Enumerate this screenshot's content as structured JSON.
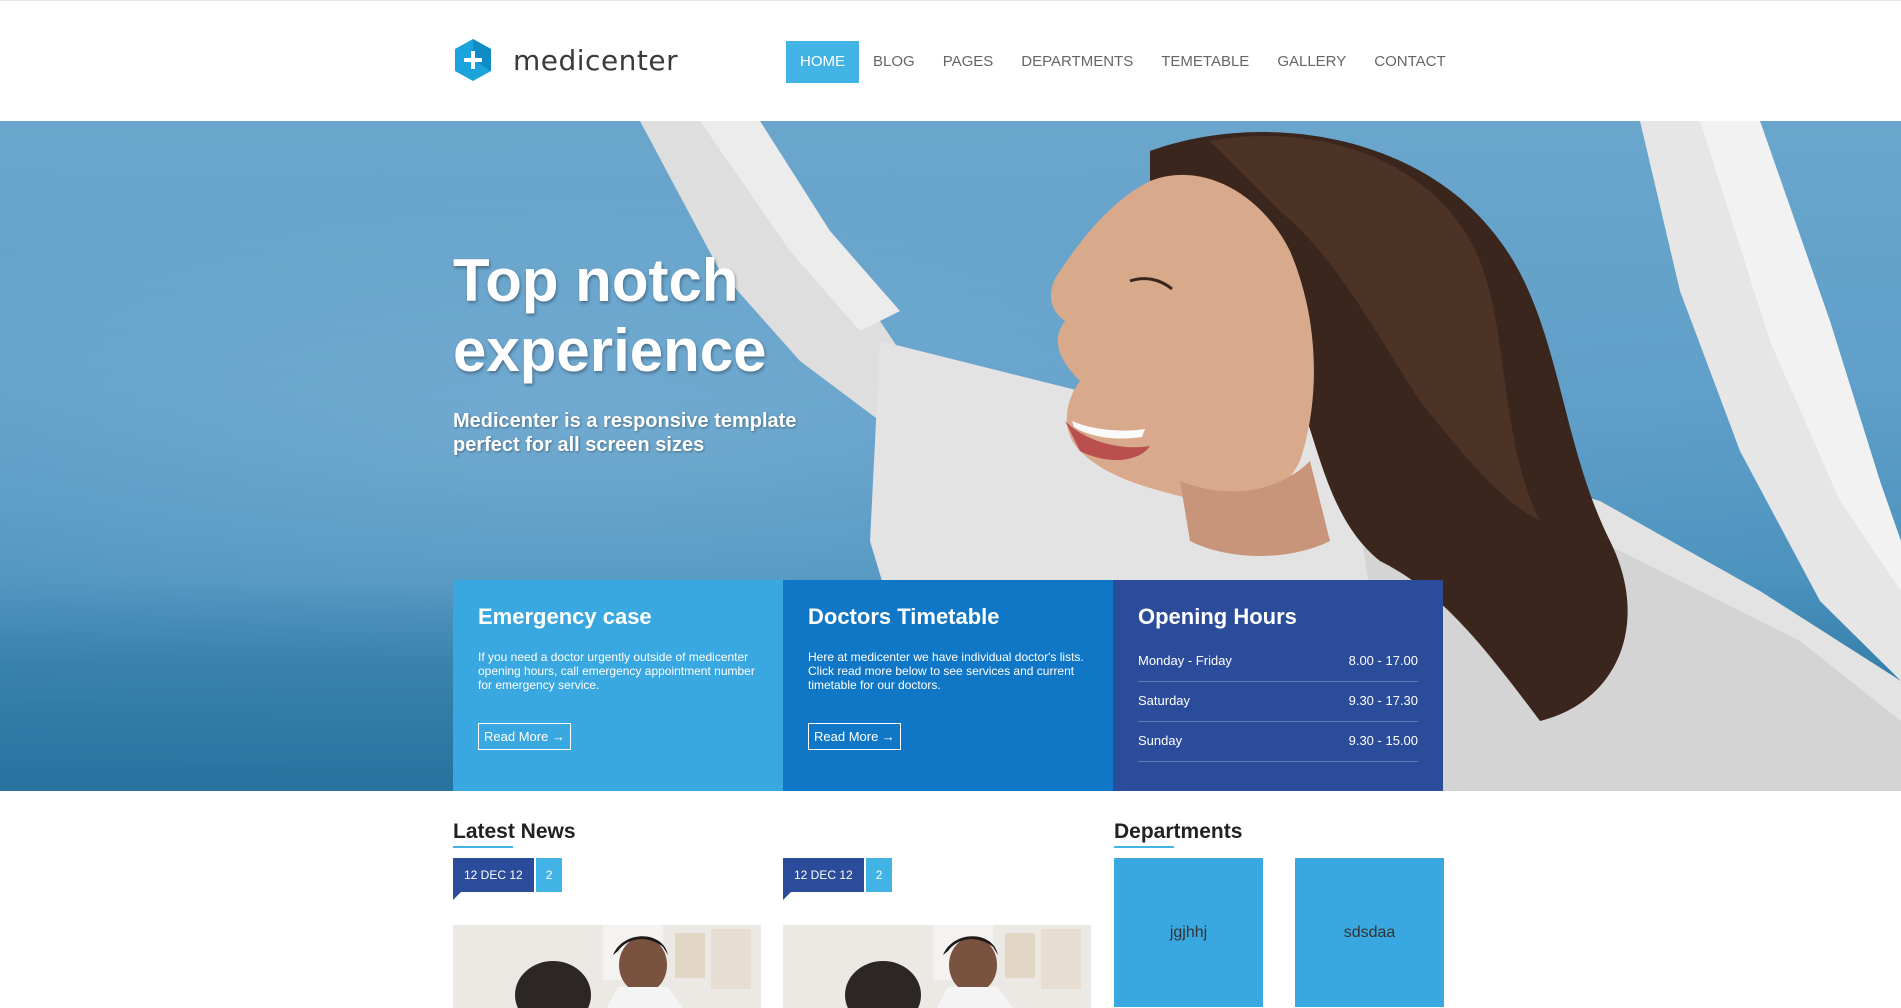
{
  "brand": {
    "name": "medicenter",
    "accent": "#42b3e5"
  },
  "nav": {
    "items": [
      {
        "label": "HOME",
        "active": true
      },
      {
        "label": "BLOG"
      },
      {
        "label": "PAGES"
      },
      {
        "label": "DEPARTMENTS"
      },
      {
        "label": "TEMETABLE"
      },
      {
        "label": "GALLERY"
      },
      {
        "label": "CONTACT"
      }
    ]
  },
  "hero": {
    "title_line1": "Top notch",
    "title_line2": "experience",
    "subtitle_line1": "Medicenter is a responsive template",
    "subtitle_line2": "perfect for all screen sizes"
  },
  "boxes": {
    "emergency": {
      "title": "Emergency case",
      "text": "If you need a doctor urgently outside of medicenter opening hours, call emergency appointment number for emergency service.",
      "button": "Read More →"
    },
    "timetable": {
      "title": "Doctors Timetable",
      "text": "Here at medicenter we have individual doctor's lists. Click read more below to see services and current timetable for our doctors.",
      "button": "Read More →"
    },
    "hours": {
      "title": "Opening Hours",
      "rows": [
        {
          "day": "Monday - Friday",
          "time": "8.00 - 17.00"
        },
        {
          "day": "Saturday",
          "time": "9.30 - 17.30"
        },
        {
          "day": "Sunday",
          "time": "9.30 - 15.00"
        }
      ]
    }
  },
  "latest_news": {
    "title": "Latest News",
    "items": [
      {
        "date": "12 DEC 12",
        "comments": "2"
      },
      {
        "date": "12 DEC 12",
        "comments": "2"
      }
    ]
  },
  "departments": {
    "title": "Departments",
    "items": [
      {
        "label": "jgjhhj"
      },
      {
        "label": "sdsdaa"
      }
    ]
  }
}
